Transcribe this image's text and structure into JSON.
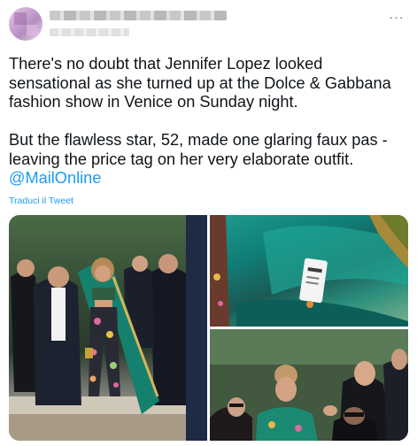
{
  "tweet": {
    "author_avatar": "avatar",
    "more_icon": "more-icon",
    "more_glyph": "···",
    "text": {
      "line1": "There's no doubt that Jennifer Lopez looked sensational as she turned up at the Dolce & Gabbana fashion show in Venice on Sunday night.",
      "line2": "But the flawless star, 52, made one glaring faux pas - leaving the price tag on her very elaborate outfit.",
      "mention": "@MailOnline"
    },
    "translate_label": "Traduci il Tweet"
  },
  "colors": {
    "link": "#1d9bf0",
    "text": "#0f1419",
    "secondary": "#536471"
  }
}
